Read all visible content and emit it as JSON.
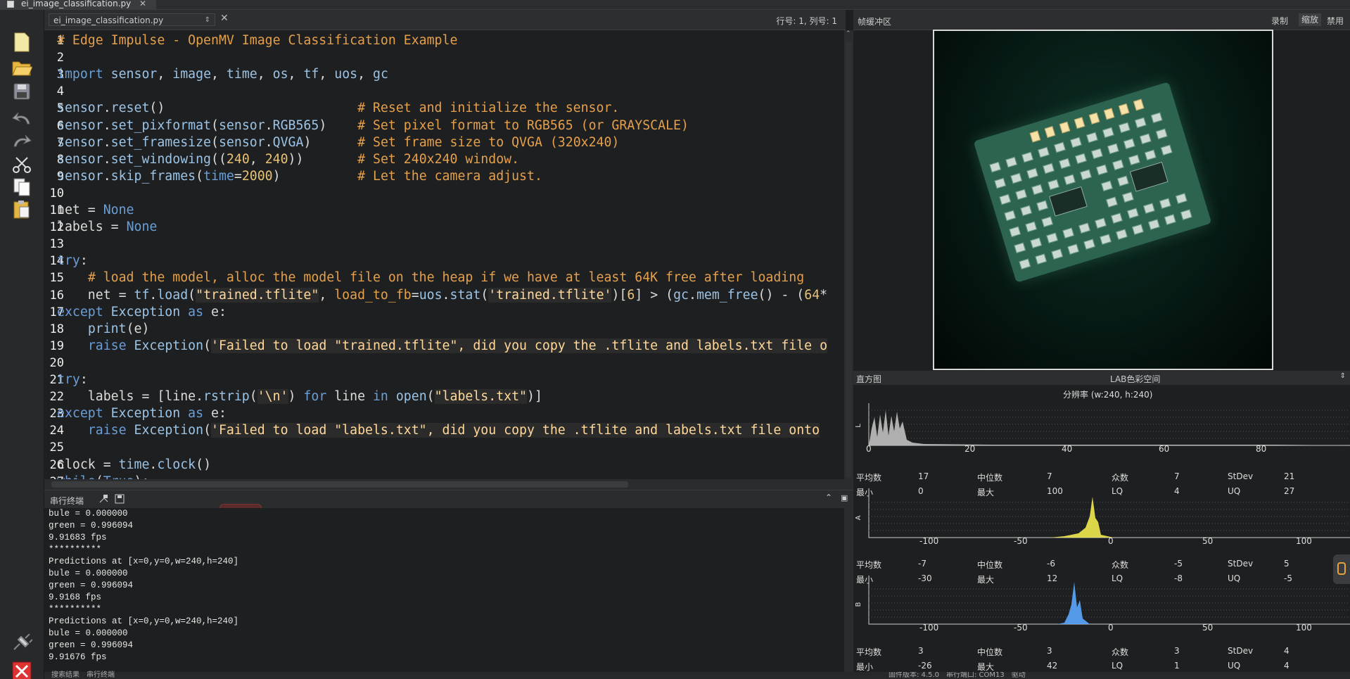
{
  "window": {
    "tab_label": "ei_image_classification.py"
  },
  "editor": {
    "file_select": "ei_image_classification.py",
    "cursor_pos": "行号: 1, 列号: 1"
  },
  "code_lines": [
    {
      "n": "1",
      "segs": [
        {
          "c": "cm",
          "t": "# Edge Impulse - OpenMV Image Classification Example"
        }
      ]
    },
    {
      "n": "2",
      "segs": []
    },
    {
      "n": "3",
      "segs": [
        {
          "c": "kw",
          "t": "import "
        },
        {
          "c": "id",
          "t": "sensor"
        },
        {
          "c": "tx",
          "t": ", "
        },
        {
          "c": "id",
          "t": "image"
        },
        {
          "c": "tx",
          "t": ", "
        },
        {
          "c": "id",
          "t": "time"
        },
        {
          "c": "tx",
          "t": ", "
        },
        {
          "c": "id",
          "t": "os"
        },
        {
          "c": "tx",
          "t": ", "
        },
        {
          "c": "id",
          "t": "tf"
        },
        {
          "c": "tx",
          "t": ", "
        },
        {
          "c": "id",
          "t": "uos"
        },
        {
          "c": "tx",
          "t": ", "
        },
        {
          "c": "id",
          "t": "gc"
        }
      ]
    },
    {
      "n": "4",
      "segs": []
    },
    {
      "n": "5",
      "segs": [
        {
          "c": "id",
          "t": "sensor"
        },
        {
          "c": "tx",
          "t": "."
        },
        {
          "c": "id",
          "t": "reset"
        },
        {
          "c": "tx",
          "t": "()                         "
        },
        {
          "c": "cm",
          "t": "# Reset and initialize the sensor."
        }
      ]
    },
    {
      "n": "6",
      "segs": [
        {
          "c": "id",
          "t": "sensor"
        },
        {
          "c": "tx",
          "t": "."
        },
        {
          "c": "id",
          "t": "set_pixformat"
        },
        {
          "c": "tx",
          "t": "("
        },
        {
          "c": "id",
          "t": "sensor"
        },
        {
          "c": "tx",
          "t": "."
        },
        {
          "c": "id",
          "t": "RGB565"
        },
        {
          "c": "tx",
          "t": ")    "
        },
        {
          "c": "cm",
          "t": "# Set pixel format to RGB565 (or GRAYSCALE)"
        }
      ]
    },
    {
      "n": "7",
      "segs": [
        {
          "c": "id",
          "t": "sensor"
        },
        {
          "c": "tx",
          "t": "."
        },
        {
          "c": "id",
          "t": "set_framesize"
        },
        {
          "c": "tx",
          "t": "("
        },
        {
          "c": "id",
          "t": "sensor"
        },
        {
          "c": "tx",
          "t": "."
        },
        {
          "c": "id",
          "t": "QVGA"
        },
        {
          "c": "tx",
          "t": ")      "
        },
        {
          "c": "cm",
          "t": "# Set frame size to QVGA (320x240)"
        }
      ]
    },
    {
      "n": "8",
      "segs": [
        {
          "c": "id",
          "t": "sensor"
        },
        {
          "c": "tx",
          "t": "."
        },
        {
          "c": "id",
          "t": "set_windowing"
        },
        {
          "c": "tx",
          "t": "(("
        },
        {
          "c": "nu",
          "t": "240"
        },
        {
          "c": "tx",
          "t": ", "
        },
        {
          "c": "nu",
          "t": "240"
        },
        {
          "c": "tx",
          "t": "))       "
        },
        {
          "c": "cm",
          "t": "# Set 240x240 window."
        }
      ]
    },
    {
      "n": "9",
      "segs": [
        {
          "c": "id",
          "t": "sensor"
        },
        {
          "c": "tx",
          "t": "."
        },
        {
          "c": "id",
          "t": "skip_frames"
        },
        {
          "c": "tx",
          "t": "("
        },
        {
          "c": "kw",
          "t": "time"
        },
        {
          "c": "tx",
          "t": "="
        },
        {
          "c": "nu",
          "t": "2000"
        },
        {
          "c": "tx",
          "t": ")          "
        },
        {
          "c": "cm",
          "t": "# Let the camera adjust."
        }
      ]
    },
    {
      "n": "10",
      "segs": []
    },
    {
      "n": "11",
      "segs": [
        {
          "c": "tx",
          "t": "net = "
        },
        {
          "c": "kw",
          "t": "None"
        }
      ]
    },
    {
      "n": "12",
      "segs": [
        {
          "c": "tx",
          "t": "labels = "
        },
        {
          "c": "kw",
          "t": "None"
        }
      ]
    },
    {
      "n": "13",
      "segs": []
    },
    {
      "n": "14",
      "segs": [
        {
          "c": "kw",
          "t": "try"
        },
        {
          "c": "tx",
          "t": ":"
        }
      ]
    },
    {
      "n": "15",
      "segs": [
        {
          "c": "tx",
          "t": "    "
        },
        {
          "c": "cm",
          "t": "# load the model, alloc the model file on the heap if we have at least 64K free after loading"
        }
      ]
    },
    {
      "n": "16",
      "segs": [
        {
          "c": "tx",
          "t": "    net = "
        },
        {
          "c": "id",
          "t": "tf"
        },
        {
          "c": "tx",
          "t": "."
        },
        {
          "c": "id",
          "t": "load"
        },
        {
          "c": "tx",
          "t": "("
        },
        {
          "c": "st",
          "t": "\"trained.tflite\""
        },
        {
          "c": "tx",
          "t": ", "
        },
        {
          "c": "cm",
          "t": "load_to_fb"
        },
        {
          "c": "tx",
          "t": "="
        },
        {
          "c": "id",
          "t": "uos"
        },
        {
          "c": "tx",
          "t": "."
        },
        {
          "c": "id",
          "t": "stat"
        },
        {
          "c": "tx",
          "t": "("
        },
        {
          "c": "st",
          "t": "'trained.tflite'"
        },
        {
          "c": "tx",
          "t": ")["
        },
        {
          "c": "nu",
          "t": "6"
        },
        {
          "c": "tx",
          "t": "] > ("
        },
        {
          "c": "id",
          "t": "gc"
        },
        {
          "c": "tx",
          "t": "."
        },
        {
          "c": "id",
          "t": "mem_free"
        },
        {
          "c": "tx",
          "t": "() - ("
        },
        {
          "c": "nu",
          "t": "64"
        },
        {
          "c": "tx",
          "t": "*"
        }
      ]
    },
    {
      "n": "17",
      "segs": [
        {
          "c": "kw",
          "t": "except "
        },
        {
          "c": "id",
          "t": "Exception"
        },
        {
          "c": "kw",
          "t": " as "
        },
        {
          "c": "tx",
          "t": "e:"
        }
      ]
    },
    {
      "n": "18",
      "segs": [
        {
          "c": "tx",
          "t": "    "
        },
        {
          "c": "id",
          "t": "print"
        },
        {
          "c": "tx",
          "t": "(e)"
        }
      ]
    },
    {
      "n": "19",
      "segs": [
        {
          "c": "tx",
          "t": "    "
        },
        {
          "c": "kw",
          "t": "raise "
        },
        {
          "c": "id",
          "t": "Exception"
        },
        {
          "c": "tx",
          "t": "("
        },
        {
          "c": "st",
          "t": "'Failed to load \"trained.tflite\", did you copy the .tflite and labels.txt file o"
        }
      ]
    },
    {
      "n": "20",
      "segs": []
    },
    {
      "n": "21",
      "segs": [
        {
          "c": "kw",
          "t": "try"
        },
        {
          "c": "tx",
          "t": ":"
        }
      ]
    },
    {
      "n": "22",
      "segs": [
        {
          "c": "tx",
          "t": "    labels = [line."
        },
        {
          "c": "id",
          "t": "rstrip"
        },
        {
          "c": "tx",
          "t": "("
        },
        {
          "c": "st",
          "t": "'\\n'"
        },
        {
          "c": "tx",
          "t": ") "
        },
        {
          "c": "kw",
          "t": "for"
        },
        {
          "c": "tx",
          "t": " line "
        },
        {
          "c": "kw",
          "t": "in"
        },
        {
          "c": "tx",
          "t": " "
        },
        {
          "c": "id",
          "t": "open"
        },
        {
          "c": "tx",
          "t": "("
        },
        {
          "c": "st",
          "t": "\"labels.txt\""
        },
        {
          "c": "tx",
          "t": ")]"
        }
      ]
    },
    {
      "n": "23",
      "segs": [
        {
          "c": "kw",
          "t": "except "
        },
        {
          "c": "id",
          "t": "Exception"
        },
        {
          "c": "kw",
          "t": " as "
        },
        {
          "c": "tx",
          "t": "e:"
        }
      ]
    },
    {
      "n": "24",
      "segs": [
        {
          "c": "tx",
          "t": "    "
        },
        {
          "c": "kw",
          "t": "raise "
        },
        {
          "c": "id",
          "t": "Exception"
        },
        {
          "c": "tx",
          "t": "("
        },
        {
          "c": "st",
          "t": "'Failed to load \"labels.txt\", did you copy the .tflite and labels.txt file onto"
        }
      ]
    },
    {
      "n": "25",
      "segs": []
    },
    {
      "n": "26",
      "segs": [
        {
          "c": "tx",
          "t": "clock = "
        },
        {
          "c": "id",
          "t": "time"
        },
        {
          "c": "tx",
          "t": "."
        },
        {
          "c": "id",
          "t": "clock"
        },
        {
          "c": "tx",
          "t": "()"
        }
      ]
    },
    {
      "n": "27",
      "segs": [
        {
          "c": "kw",
          "t": "while"
        },
        {
          "c": "tx",
          "t": "("
        },
        {
          "c": "kw",
          "t": "True"
        },
        {
          "c": "tx",
          "t": "):"
        }
      ]
    }
  ],
  "terminal": {
    "title": "串行终端",
    "lines": [
      "bule = 0.000000",
      "green = 0.996094",
      "9.91683 fps",
      "**********",
      "Predictions at [x=0,y=0,w=240,h=240]",
      "bule = 0.000000",
      "green = 0.996094",
      "9.9168 fps",
      "**********",
      "Predictions at [x=0,y=0,w=240,h=240]",
      "bule = 0.000000",
      "green = 0.996094",
      "9.91676 fps"
    ]
  },
  "bottom_tabs": [
    "搜索结果",
    "串行终端"
  ],
  "framebuffer": {
    "title": "帧缓冲区",
    "buttons": [
      "录制",
      "缩放",
      "禁用"
    ]
  },
  "histogram": {
    "title": "直方图",
    "colorspace": "LAB色彩空间",
    "resolution": "分辨率 (w:240, h:240)",
    "channels": [
      {
        "label": "L",
        "ticks": [
          "0",
          "20",
          "40",
          "60",
          "80"
        ],
        "color": "#bfbfbf",
        "stats": {
          "平均数": "17",
          "中位数": "7",
          "众数": "7",
          "StDev": "21",
          "最小": "0",
          "最大": "100",
          "LQ": "4",
          "UQ": "27"
        }
      },
      {
        "label": "A",
        "ticks": [
          "-100",
          "-50",
          "0",
          "50",
          "100"
        ],
        "color": "#f2e94e",
        "stats": {
          "平均数": "-7",
          "中位数": "-6",
          "众数": "-5",
          "StDev": "5",
          "最小": "-30",
          "最大": "12",
          "LQ": "-8",
          "UQ": "-5"
        }
      },
      {
        "label": "B",
        "ticks": [
          "-100",
          "-50",
          "0",
          "50",
          "100"
        ],
        "color": "#5aa7ff",
        "stats": {
          "平均数": "3",
          "中位数": "3",
          "众数": "3",
          "StDev": "4",
          "最小": "-26",
          "最大": "42",
          "LQ": "1",
          "UQ": "4"
        }
      }
    ]
  },
  "statusbar": [
    "固件版本: 4.5.0",
    "串行端口: COM13",
    "驱动"
  ]
}
